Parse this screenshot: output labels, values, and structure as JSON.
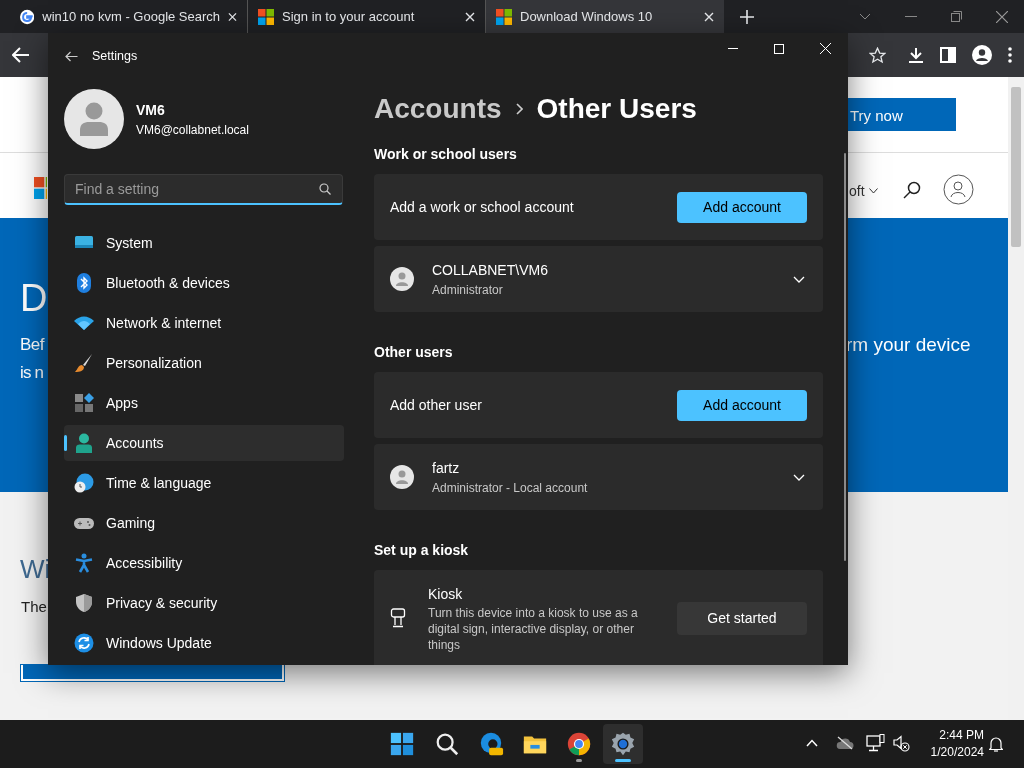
{
  "browser": {
    "tabs": [
      {
        "kind": "google",
        "title": "win10 no kvm - Google Search",
        "selected": false
      },
      {
        "kind": "microsoft",
        "title": "Sign in to your account",
        "selected": false
      },
      {
        "kind": "microsoft",
        "title": "Download Windows 10",
        "selected": true
      }
    ],
    "page": {
      "header_button": "Try now",
      "nav_text": "oft",
      "hero": {
        "heading": "D",
        "line_1": "Bef",
        "line_2": "is n",
        "line_right": "rm your device"
      },
      "section": {
        "heading": "Wi",
        "text": "The"
      }
    }
  },
  "settings": {
    "title": "Settings",
    "user": {
      "name": "VM6",
      "email": "VM6@collabnet.local"
    },
    "search": {
      "placeholder": "Find a setting"
    },
    "nav": [
      {
        "kind": "system",
        "label": "System",
        "selected": false
      },
      {
        "kind": "bluetooth",
        "label": "Bluetooth & devices",
        "selected": false
      },
      {
        "kind": "network",
        "label": "Network & internet",
        "selected": false
      },
      {
        "kind": "personalization",
        "label": "Personalization",
        "selected": false
      },
      {
        "kind": "apps",
        "label": "Apps",
        "selected": false
      },
      {
        "kind": "accounts",
        "label": "Accounts",
        "selected": true
      },
      {
        "kind": "time",
        "label": "Time & language",
        "selected": false
      },
      {
        "kind": "gaming",
        "label": "Gaming",
        "selected": false
      },
      {
        "kind": "accessibility",
        "label": "Accessibility",
        "selected": false
      },
      {
        "kind": "privacy",
        "label": "Privacy & security",
        "selected": false
      },
      {
        "kind": "update",
        "label": "Windows Update",
        "selected": false
      }
    ],
    "breadcrumb": [
      "Accounts",
      "Other Users"
    ],
    "sections": [
      {
        "heading": "Work or school users",
        "cards": [
          {
            "kind": "action",
            "label": "Add a work or school account",
            "button": "Add account"
          },
          {
            "kind": "user",
            "name": "COLLABNET\\VM6",
            "role": "Administrator",
            "expanded": false
          }
        ]
      },
      {
        "heading": "Other users",
        "cards": [
          {
            "kind": "action",
            "label": "Add other user",
            "button": "Add account"
          },
          {
            "kind": "user",
            "name": "fartz",
            "role": "Administrator - Local account",
            "expanded": false
          }
        ]
      },
      {
        "heading": "Set up a kiosk",
        "cards": [
          {
            "kind": "kiosk",
            "title": "Kiosk",
            "description": "Turn this device into a kiosk to use as a digital sign, interactive display, or other things",
            "button": "Get started"
          }
        ]
      }
    ]
  },
  "taskbar": {
    "apps": [
      {
        "kind": "start",
        "running": false,
        "selected": false
      },
      {
        "kind": "search",
        "running": false,
        "selected": false
      },
      {
        "kind": "edge",
        "running": false,
        "selected": false
      },
      {
        "kind": "explorer",
        "running": false,
        "selected": false
      },
      {
        "kind": "chrome",
        "running": true,
        "selected": false
      },
      {
        "kind": "settings",
        "running": true,
        "selected": true
      }
    ],
    "time": "2:44 PM",
    "date": "1/20/2024"
  }
}
